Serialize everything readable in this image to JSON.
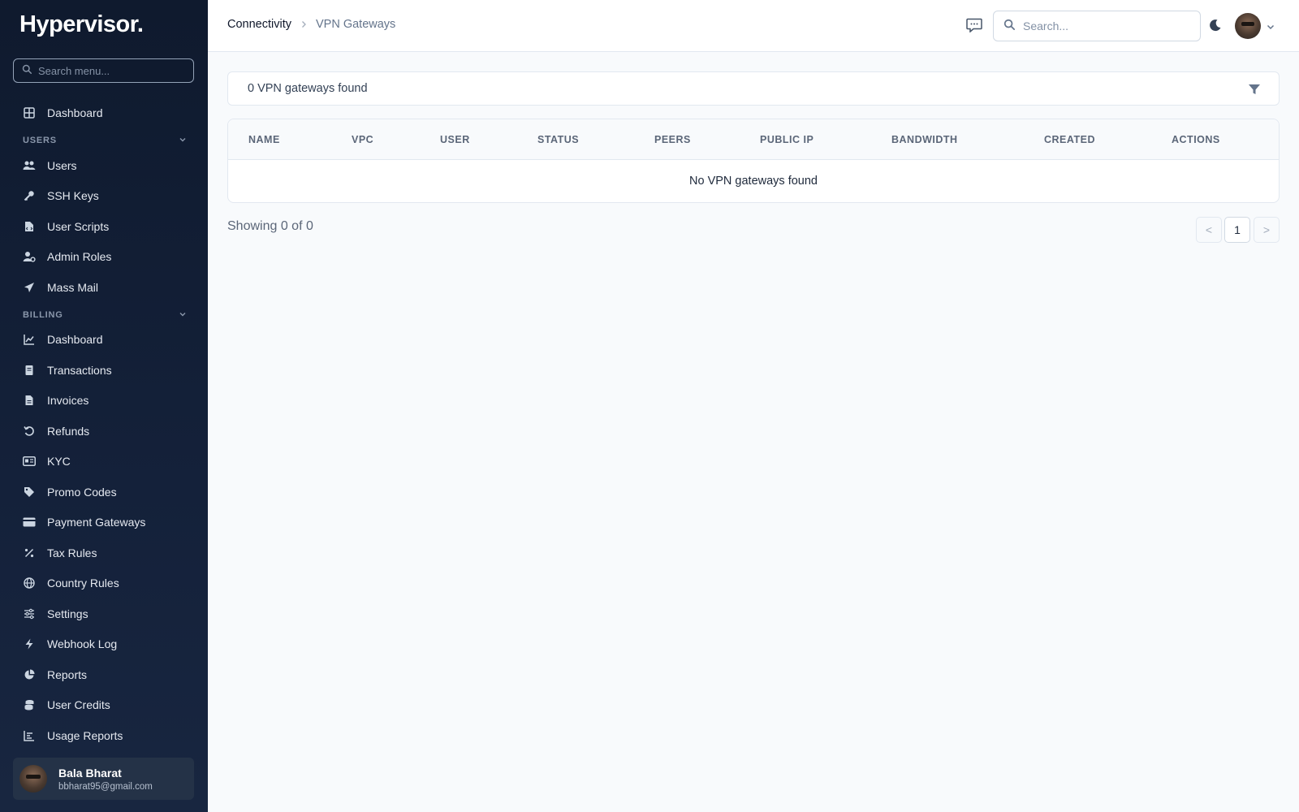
{
  "app": {
    "logo": "Hypervisor."
  },
  "sidebar": {
    "search_placeholder": "Search menu...",
    "top_item": {
      "label": "Dashboard",
      "icon": "grid-icon"
    },
    "sections": [
      {
        "label": "USERS",
        "items": [
          {
            "label": "Users",
            "icon": "users-icon"
          },
          {
            "label": "SSH Keys",
            "icon": "key-icon"
          },
          {
            "label": "User Scripts",
            "icon": "file-code-icon"
          },
          {
            "label": "Admin Roles",
            "icon": "user-cog-icon"
          },
          {
            "label": "Mass Mail",
            "icon": "paper-plane-icon"
          }
        ]
      },
      {
        "label": "BILLING",
        "items": [
          {
            "label": "Dashboard",
            "icon": "line-chart-icon"
          },
          {
            "label": "Transactions",
            "icon": "receipt-icon"
          },
          {
            "label": "Invoices",
            "icon": "file-icon"
          },
          {
            "label": "Refunds",
            "icon": "undo-icon"
          },
          {
            "label": "KYC",
            "icon": "id-card-icon"
          },
          {
            "label": "Promo Codes",
            "icon": "tag-icon"
          },
          {
            "label": "Payment Gateways",
            "icon": "credit-card-icon"
          },
          {
            "label": "Tax Rules",
            "icon": "percent-icon"
          },
          {
            "label": "Country Rules",
            "icon": "globe-icon"
          },
          {
            "label": "Settings",
            "icon": "sliders-icon"
          },
          {
            "label": "Webhook Log",
            "icon": "bolt-icon"
          },
          {
            "label": "Reports",
            "icon": "pie-chart-icon"
          },
          {
            "label": "User Credits",
            "icon": "coins-icon"
          },
          {
            "label": "Usage Reports",
            "icon": "bar-chart-icon"
          }
        ]
      }
    ],
    "user": {
      "name": "Bala Bharat",
      "email": "bbharat95@gmail.com"
    }
  },
  "header": {
    "breadcrumb": [
      "Connectivity",
      "VPN Gateways"
    ],
    "search_placeholder": "Search..."
  },
  "main": {
    "result_count": "0 VPN gateways found",
    "columns": [
      "NAME",
      "VPC",
      "USER",
      "STATUS",
      "PEERS",
      "PUBLIC IP",
      "BANDWIDTH",
      "CREATED",
      "ACTIONS"
    ],
    "empty_message": "No VPN gateways found",
    "showing": "Showing 0 of 0",
    "pagination": {
      "prev": "<",
      "current": "1",
      "next": ">"
    }
  },
  "colors": {
    "sidebar_bg": "#0f1a2e",
    "page_bg": "#f8fafc",
    "accent_text": "#0f172a"
  }
}
